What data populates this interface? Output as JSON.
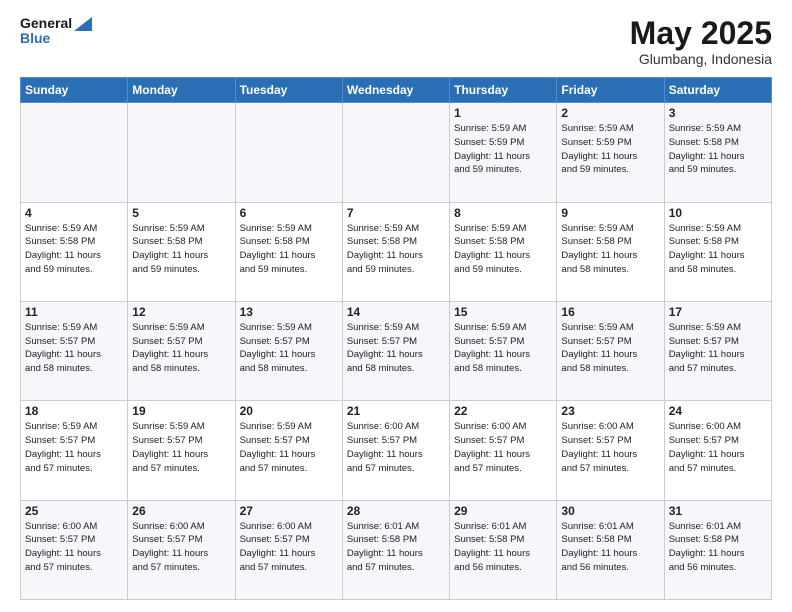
{
  "header": {
    "logo_line1": "General",
    "logo_line2": "Blue",
    "month": "May 2025",
    "location": "Glumbang, Indonesia"
  },
  "weekdays": [
    "Sunday",
    "Monday",
    "Tuesday",
    "Wednesday",
    "Thursday",
    "Friday",
    "Saturday"
  ],
  "weeks": [
    [
      {
        "day": "",
        "info": ""
      },
      {
        "day": "",
        "info": ""
      },
      {
        "day": "",
        "info": ""
      },
      {
        "day": "",
        "info": ""
      },
      {
        "day": "1",
        "info": "Sunrise: 5:59 AM\nSunset: 5:59 PM\nDaylight: 11 hours\nand 59 minutes."
      },
      {
        "day": "2",
        "info": "Sunrise: 5:59 AM\nSunset: 5:59 PM\nDaylight: 11 hours\nand 59 minutes."
      },
      {
        "day": "3",
        "info": "Sunrise: 5:59 AM\nSunset: 5:58 PM\nDaylight: 11 hours\nand 59 minutes."
      }
    ],
    [
      {
        "day": "4",
        "info": "Sunrise: 5:59 AM\nSunset: 5:58 PM\nDaylight: 11 hours\nand 59 minutes."
      },
      {
        "day": "5",
        "info": "Sunrise: 5:59 AM\nSunset: 5:58 PM\nDaylight: 11 hours\nand 59 minutes."
      },
      {
        "day": "6",
        "info": "Sunrise: 5:59 AM\nSunset: 5:58 PM\nDaylight: 11 hours\nand 59 minutes."
      },
      {
        "day": "7",
        "info": "Sunrise: 5:59 AM\nSunset: 5:58 PM\nDaylight: 11 hours\nand 59 minutes."
      },
      {
        "day": "8",
        "info": "Sunrise: 5:59 AM\nSunset: 5:58 PM\nDaylight: 11 hours\nand 59 minutes."
      },
      {
        "day": "9",
        "info": "Sunrise: 5:59 AM\nSunset: 5:58 PM\nDaylight: 11 hours\nand 58 minutes."
      },
      {
        "day": "10",
        "info": "Sunrise: 5:59 AM\nSunset: 5:58 PM\nDaylight: 11 hours\nand 58 minutes."
      }
    ],
    [
      {
        "day": "11",
        "info": "Sunrise: 5:59 AM\nSunset: 5:57 PM\nDaylight: 11 hours\nand 58 minutes."
      },
      {
        "day": "12",
        "info": "Sunrise: 5:59 AM\nSunset: 5:57 PM\nDaylight: 11 hours\nand 58 minutes."
      },
      {
        "day": "13",
        "info": "Sunrise: 5:59 AM\nSunset: 5:57 PM\nDaylight: 11 hours\nand 58 minutes."
      },
      {
        "day": "14",
        "info": "Sunrise: 5:59 AM\nSunset: 5:57 PM\nDaylight: 11 hours\nand 58 minutes."
      },
      {
        "day": "15",
        "info": "Sunrise: 5:59 AM\nSunset: 5:57 PM\nDaylight: 11 hours\nand 58 minutes."
      },
      {
        "day": "16",
        "info": "Sunrise: 5:59 AM\nSunset: 5:57 PM\nDaylight: 11 hours\nand 58 minutes."
      },
      {
        "day": "17",
        "info": "Sunrise: 5:59 AM\nSunset: 5:57 PM\nDaylight: 11 hours\nand 57 minutes."
      }
    ],
    [
      {
        "day": "18",
        "info": "Sunrise: 5:59 AM\nSunset: 5:57 PM\nDaylight: 11 hours\nand 57 minutes."
      },
      {
        "day": "19",
        "info": "Sunrise: 5:59 AM\nSunset: 5:57 PM\nDaylight: 11 hours\nand 57 minutes."
      },
      {
        "day": "20",
        "info": "Sunrise: 5:59 AM\nSunset: 5:57 PM\nDaylight: 11 hours\nand 57 minutes."
      },
      {
        "day": "21",
        "info": "Sunrise: 6:00 AM\nSunset: 5:57 PM\nDaylight: 11 hours\nand 57 minutes."
      },
      {
        "day": "22",
        "info": "Sunrise: 6:00 AM\nSunset: 5:57 PM\nDaylight: 11 hours\nand 57 minutes."
      },
      {
        "day": "23",
        "info": "Sunrise: 6:00 AM\nSunset: 5:57 PM\nDaylight: 11 hours\nand 57 minutes."
      },
      {
        "day": "24",
        "info": "Sunrise: 6:00 AM\nSunset: 5:57 PM\nDaylight: 11 hours\nand 57 minutes."
      }
    ],
    [
      {
        "day": "25",
        "info": "Sunrise: 6:00 AM\nSunset: 5:57 PM\nDaylight: 11 hours\nand 57 minutes."
      },
      {
        "day": "26",
        "info": "Sunrise: 6:00 AM\nSunset: 5:57 PM\nDaylight: 11 hours\nand 57 minutes."
      },
      {
        "day": "27",
        "info": "Sunrise: 6:00 AM\nSunset: 5:57 PM\nDaylight: 11 hours\nand 57 minutes."
      },
      {
        "day": "28",
        "info": "Sunrise: 6:01 AM\nSunset: 5:58 PM\nDaylight: 11 hours\nand 57 minutes."
      },
      {
        "day": "29",
        "info": "Sunrise: 6:01 AM\nSunset: 5:58 PM\nDaylight: 11 hours\nand 56 minutes."
      },
      {
        "day": "30",
        "info": "Sunrise: 6:01 AM\nSunset: 5:58 PM\nDaylight: 11 hours\nand 56 minutes."
      },
      {
        "day": "31",
        "info": "Sunrise: 6:01 AM\nSunset: 5:58 PM\nDaylight: 11 hours\nand 56 minutes."
      }
    ]
  ]
}
